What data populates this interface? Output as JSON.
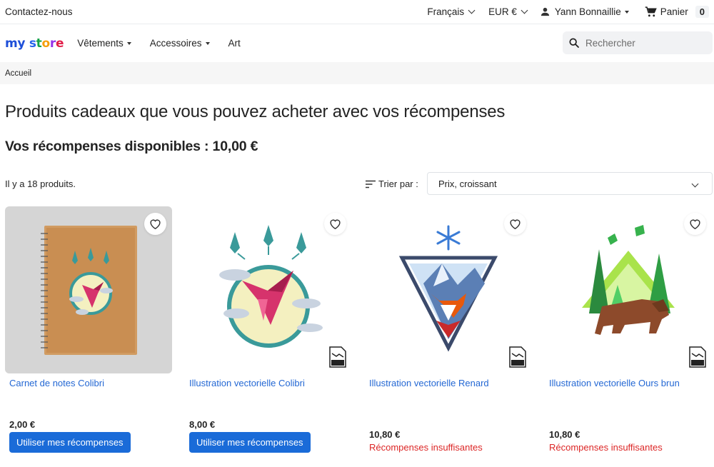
{
  "topbar": {
    "contact": "Contactez-nous",
    "language": "Français",
    "currency": "EUR €",
    "user": "Yann Bonnaillie",
    "cart_label": "Panier",
    "cart_count": "0"
  },
  "header": {
    "logo": [
      "my",
      " ",
      "s",
      "t",
      "o",
      "r",
      "e"
    ],
    "nav": [
      "Vêtements",
      "Accessoires",
      "Art"
    ],
    "search_placeholder": "Rechercher"
  },
  "breadcrumb": "Accueil",
  "page_title": "Produits cadeaux que vous pouvez acheter avec vos récompenses",
  "rewards_available": "Vos récompenses disponibles : 10,00 €",
  "product_count": "Il y a 18 produits.",
  "sort": {
    "label": "Trier par :",
    "selected": "Prix, croissant"
  },
  "colors": {
    "link": "#2468d4",
    "button": "#1a6bd8",
    "error": "#dc2626"
  },
  "products": [
    {
      "name": "Carnet de notes Colibri",
      "price": "2,00 €",
      "action": "Utiliser mes récompenses",
      "image": "notebook-hummingbird"
    },
    {
      "name": "Illustration vectorielle Colibri",
      "price": "8,00 €",
      "action": "Utiliser mes récompenses",
      "image": "hummingbird-illustration"
    },
    {
      "name": "Illustration vectorielle Renard",
      "price": "10,80 €",
      "status": "Récompenses insuffisantes",
      "image": "fox-illustration"
    },
    {
      "name": "Illustration vectorielle Ours brun",
      "price": "10,80 €",
      "status": "Récompenses insuffisantes",
      "image": "bear-illustration"
    }
  ]
}
